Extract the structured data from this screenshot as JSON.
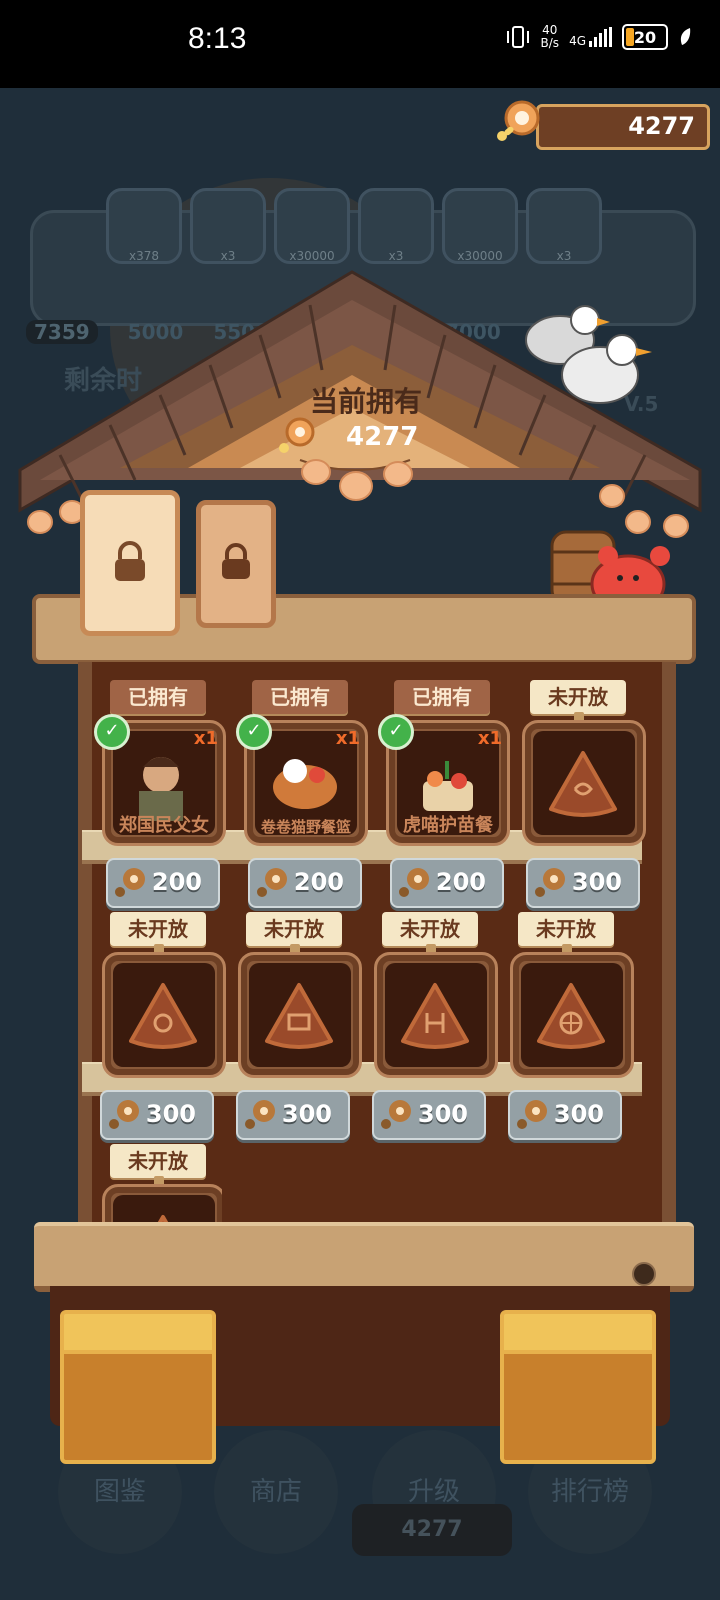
{
  "status_bar": {
    "time": "8:13",
    "net_speed": "40",
    "net_unit": "B/s",
    "net_type": "4G",
    "battery": "20"
  },
  "background": {
    "slots": [
      {
        "caption": "x378"
      },
      {
        "caption": "x3"
      },
      {
        "caption": "x30000"
      },
      {
        "caption": "x3"
      },
      {
        "caption": "x30000"
      },
      {
        "caption": "x3"
      }
    ],
    "progress_numbers": [
      "7359",
      "5000",
      "550",
      "7000",
      "7"
    ],
    "side_text": "剩余时",
    "level_text": "V.5",
    "nav": [
      "图鉴",
      "商店",
      "升级",
      "排行榜"
    ],
    "coin_bar": "4277"
  },
  "coin_counter": {
    "value": "4277"
  },
  "house": {
    "title": "当前拥有",
    "count": "4277"
  },
  "items_row1": [
    {
      "tag": "已拥有",
      "name": "郑国民父女",
      "mult": "x1",
      "price": "200",
      "owned": true
    },
    {
      "tag": "已拥有",
      "name": "卷卷猫野餐篮",
      "mult": "x1",
      "price": "200",
      "owned": true
    },
    {
      "tag": "已拥有",
      "name": "虎喵护苗餐",
      "mult": "x1",
      "price": "200",
      "owned": true
    },
    {
      "tag": "未开放",
      "name": "",
      "mult": "",
      "price": "300",
      "owned": false
    }
  ],
  "items_row2": [
    {
      "tag": "未开放",
      "price": "300"
    },
    {
      "tag": "未开放",
      "price": "300"
    },
    {
      "tag": "未开放",
      "price": "300"
    },
    {
      "tag": "未开放",
      "price": "300"
    }
  ],
  "items_row3": [
    {
      "tag": "未开放"
    }
  ],
  "colors": {
    "wood_dark": "#5a2b15",
    "plank": "#d7c39c",
    "price_grey": "#94a0a5",
    "owned_check": "#43b24a"
  }
}
